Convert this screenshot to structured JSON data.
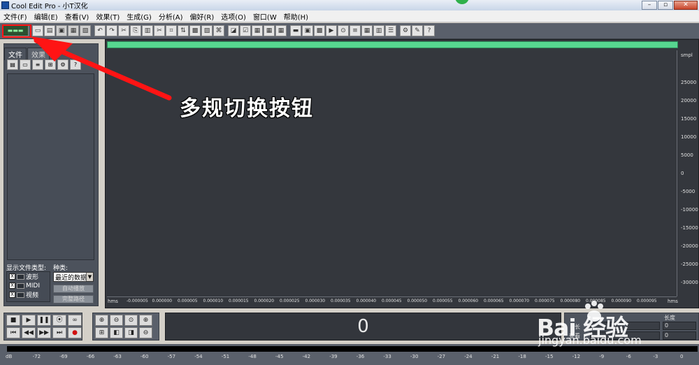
{
  "window": {
    "title": "Cool Edit Pro  - 小T汉化",
    "minimize": "–",
    "maximize": "▫",
    "close": "✕"
  },
  "menu": [
    {
      "label": "文件(F)"
    },
    {
      "label": "编辑(E)"
    },
    {
      "label": "查看(V)"
    },
    {
      "label": "效果(T)"
    },
    {
      "label": "生成(G)"
    },
    {
      "label": "分析(A)"
    },
    {
      "label": "偏好(R)"
    },
    {
      "label": "选项(O)"
    },
    {
      "label": "窗口(W"
    },
    {
      "label": "帮助(H)"
    }
  ],
  "toolbar": {
    "mode_switch_label": "▬▬▬",
    "colors": {
      "panel": "#5a606b",
      "mode_button": "#2c5030",
      "progress": "#57d690",
      "annotation_red": "#ff1414"
    }
  },
  "left_panel": {
    "tabs": [
      {
        "label": "文件"
      },
      {
        "label": "效果"
      }
    ],
    "filter_label": "显示文件类型:",
    "kind_label": "种类:",
    "filters": [
      {
        "label": "波形",
        "checked": "X"
      },
      {
        "label": "MIDI",
        "checked": "X"
      },
      {
        "label": "视频",
        "checked": "X"
      }
    ],
    "kind_value": "最近的数据",
    "auto_play": "自动播放",
    "full_path": "完整路径"
  },
  "waveform": {
    "y_unit": "smpl",
    "y_ticks": [
      "25000",
      "20000",
      "15000",
      "10000",
      "5000",
      "0",
      "-5000",
      "-10000",
      "-15000",
      "-20000",
      "-25000",
      "-30000"
    ],
    "x_unit_left": "hms",
    "x_unit_right": "hms",
    "x_ticks": [
      "-0.000005",
      "0.000000",
      "0.000005",
      "0.000010",
      "0.000015",
      "0.000020",
      "0.000025",
      "0.000030",
      "0.000035",
      "0.000040",
      "0.000045",
      "0.000050",
      "0.000055",
      "0.000060",
      "0.000065",
      "0.000070",
      "0.000075",
      "0.000080",
      "0.000085",
      "0.000090",
      "0.000095"
    ]
  },
  "time_display": "0",
  "selection": {
    "length_label": "长度",
    "start_label": "长",
    "view_label": "查看",
    "value_0": "0",
    "value_1": "0"
  },
  "meter_ticks": [
    "dB",
    "-72",
    "-69",
    "-66",
    "-63",
    "-60",
    "-57",
    "-54",
    "-51",
    "-48",
    "-45",
    "-42",
    "-39",
    "-36",
    "-33",
    "-30",
    "-27",
    "-24",
    "-21",
    "-18",
    "-15",
    "-12",
    "-9",
    "-6",
    "-3",
    "0"
  ],
  "annotation": "多规切换按钮",
  "watermark": {
    "logo": "Bai  经验",
    "url": "jingyan.baidu.com"
  }
}
